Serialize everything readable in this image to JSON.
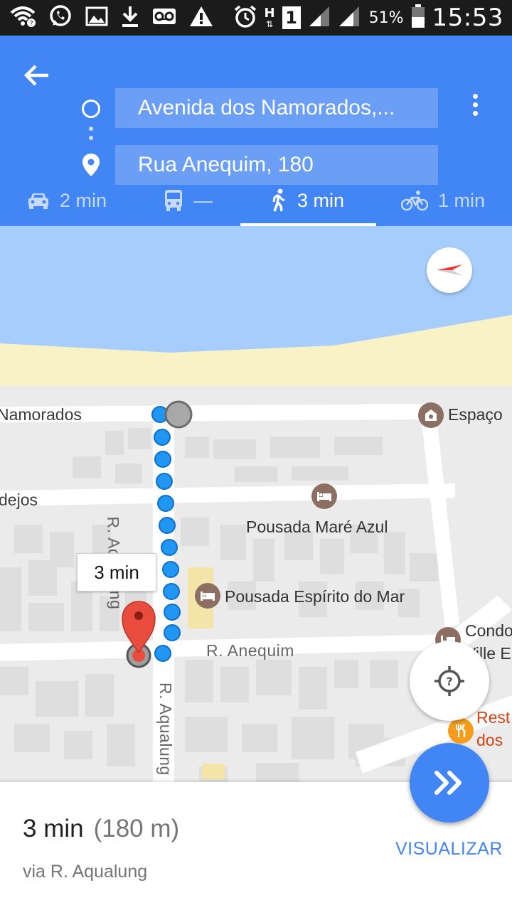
{
  "status_bar": {
    "battery_percent": "51%",
    "clock": "15:53",
    "network_type": "H",
    "sim_slot": "1",
    "icons": [
      "wifi-icon",
      "whatsapp-icon",
      "gallery-icon",
      "download-icon",
      "voicemail-icon",
      "warning-icon",
      "alarm-icon",
      "signal-icon",
      "battery-icon"
    ]
  },
  "directions": {
    "origin": "Avenida dos Namorados,...",
    "destination": "Rua Anequim, 180",
    "modes": [
      {
        "id": "drive",
        "icon": "car-icon",
        "label": "2 min"
      },
      {
        "id": "transit",
        "icon": "bus-icon",
        "label": "—"
      },
      {
        "id": "walk",
        "icon": "walk-icon",
        "label": "3 min"
      },
      {
        "id": "bike",
        "icon": "bike-icon",
        "label": "1 min"
      }
    ],
    "selected_mode": "walk"
  },
  "map": {
    "streets": {
      "namorados": "Namorados",
      "dejos": "dejos",
      "aqualung_north": "R. Aqualung",
      "aqualung_south": "R. Aqualung",
      "anequim": "R. Anequim"
    },
    "pois": {
      "espaco": "Espaço",
      "pousada_mare": "Pousada Maré Azul",
      "pousada_espirito": "Pousada Espírito do Mar",
      "condo_line1": "Condo",
      "condo_line2": "Ville E",
      "rest_line1": "Rest",
      "rest_line2": "dos"
    },
    "route_time_label": "3 min",
    "colors": {
      "water": "#a7cdfd",
      "sand": "#faf2c7",
      "route": "#2196f3",
      "destination_pin": "#e84c3d"
    }
  },
  "summary": {
    "time": "3 min",
    "distance": "(180 m)",
    "via": "via R. Aqualung",
    "visualize_label": "VISUALIZAR"
  },
  "colors": {
    "header": "#4285f4",
    "status_bar": "#1b1b1b"
  }
}
